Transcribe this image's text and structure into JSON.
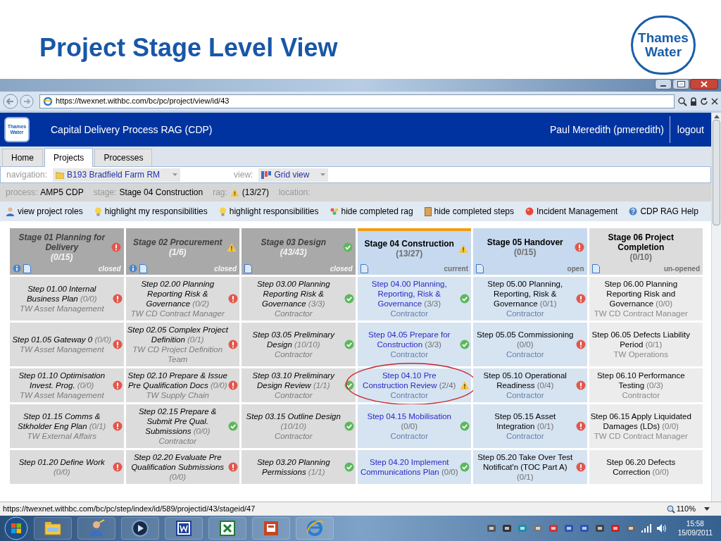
{
  "slide": {
    "title": "Project Stage Level View",
    "logo": [
      "Thames",
      "Water"
    ]
  },
  "browser": {
    "url": "https://twexnet.withbc.com/bc/pc/project/view/id/43",
    "status_url": "https://twexnet.withbc.com/bc/pc/step/index/id/589/projectid/43/stageid/47",
    "zoom": "110%"
  },
  "app": {
    "logo": [
      "Thames",
      "Water"
    ],
    "title": "Capital Delivery Process RAG (CDP)",
    "user": "Paul Meredith (pmeredith)",
    "logout": "logout"
  },
  "tabs": [
    {
      "label": "Home",
      "selected": false
    },
    {
      "label": "Projects",
      "selected": true
    },
    {
      "label": "Processes",
      "selected": false
    }
  ],
  "navigation": {
    "label": "navigation:",
    "value": "B193 Bradfield Farm RM",
    "view_label": "view:",
    "view_value": "Grid view"
  },
  "info_bar": [
    {
      "label": "process:",
      "value": "AMP5 CDP"
    },
    {
      "label": "stage:",
      "value": "Stage 04 Construction"
    },
    {
      "label": "rag:",
      "value": "(13/27)",
      "color": "#f6c744"
    },
    {
      "label": "location:"
    }
  ],
  "toolbar": [
    {
      "kind": "person",
      "label": "view project roles"
    },
    {
      "kind": "bulb",
      "label": "highlight my responsibilities"
    },
    {
      "kind": "bulb",
      "label": "highlight responsibilities"
    },
    {
      "kind": "dots",
      "label": "hide completed rag"
    },
    {
      "kind": "box",
      "label": "hide completed steps"
    },
    {
      "kind": "ball",
      "label": "Incident Management"
    },
    {
      "kind": "help",
      "label": "CDP RAG Help"
    }
  ],
  "stages": [
    {
      "title": "Stage 01 Planning for Delivery",
      "count": "(0/15)",
      "color": "#e2574c",
      "status": "closed",
      "kind": "closed",
      "info": true,
      "steps": [
        {
          "title": "Step 01.00 Internal Business Plan",
          "count": "(0/0)",
          "owner": "TW Asset Management",
          "color": "#e2574c"
        },
        {
          "title": "Step 01.05 Gateway 0",
          "count": "(0/0)",
          "owner": "TW Asset Management",
          "color": "#e2574c"
        },
        {
          "title": "Step 01.10 Optimisation Invest. Prog.",
          "count": "(0/0)",
          "owner": "TW Asset Management",
          "color": "#e2574c"
        },
        {
          "title": "Step 01.15 Comms & Stkholder Eng Plan",
          "count": "(0/1)",
          "owner": "TW External Affairs",
          "color": "#e2574c"
        },
        {
          "title": "Step 01.20 Define Work",
          "count": "(0/0)",
          "color": "#e2574c"
        }
      ]
    },
    {
      "title": "Stage 02 Procurement",
      "count": "(1/6)",
      "color": "#f6c744",
      "status": "closed",
      "kind": "closed",
      "info": true,
      "steps": [
        {
          "title": "Step 02.00 Planning Reporting Risk & Governance",
          "count": "(0/2)",
          "owner": "TW CD Contract Manager",
          "color": "#e2574c"
        },
        {
          "title": "Step 02.05 Complex Project Definition",
          "count": "(0/1)",
          "owner": "TW CD Project Definition Team",
          "color": "#e2574c"
        },
        {
          "title": "Step 02.10 Prepare & Issue Pre Qualification Docs",
          "count": "(0/0)",
          "owner": "TW Supply Chain",
          "color": "#e2574c"
        },
        {
          "title": "Step 02.15 Prepare & Submit Pre Qual. Submissions",
          "count": "(0/0)",
          "owner": "Contractor",
          "color": "#5cb85c"
        },
        {
          "title": "Step 02.20 Evaluate Pre Qualification Submissions",
          "count": "(0/0)",
          "color": "#e2574c"
        }
      ]
    },
    {
      "title": "Stage 03 Design",
      "count": "(43/43)",
      "color": "#5cb85c",
      "status": "closed",
      "kind": "closed",
      "info": false,
      "steps": [
        {
          "title": "Step 03.00 Planning Reporting Risk & Governance",
          "count": "(3/3)",
          "owner": "Contractor",
          "color": "#5cb85c"
        },
        {
          "title": "Step 03.05 Preliminary Design",
          "count": "(10/10)",
          "owner": "Contractor",
          "color": "#5cb85c"
        },
        {
          "title": "Step 03.10 Preliminary Design Review",
          "count": "(1/1)",
          "owner": "Contractor",
          "color": "#5cb85c"
        },
        {
          "title": "Step 03.15 Outline Design",
          "count": "(10/10)",
          "owner": "Contractor",
          "color": "#5cb85c"
        },
        {
          "title": "Step 03.20 Planning Permissions",
          "count": "(1/1)",
          "color": "#5cb85c"
        }
      ]
    },
    {
      "title": "Stage 04 Construction",
      "count": "(13/27)",
      "color": "#f6c744",
      "status": "current",
      "kind": "current",
      "info": false,
      "steps": [
        {
          "title": "Step 04.00 Planning, Reporting, Risk & Governance",
          "count": "(3/3)",
          "owner": "Contractor",
          "color": "#5cb85c"
        },
        {
          "title": "Step 04.05 Prepare for Construction",
          "count": "(3/3)",
          "owner": "Contractor",
          "color": "#5cb85c"
        },
        {
          "title": "Step 04.10 Pre Construction Review",
          "count": "(2/4)",
          "owner": "Contractor",
          "color": "#f6c744",
          "circled": true
        },
        {
          "title": "Step 04.15 Mobilisation",
          "count": "(0/0)",
          "owner": "Contractor",
          "color": "#5cb85c"
        },
        {
          "title": "Step 04.20 Implement Communications Plan",
          "count": "(0/0)",
          "color": "#5cb85c"
        }
      ]
    },
    {
      "title": "Stage 05 Handover",
      "count": "(0/15)",
      "color": "#e2574c",
      "status": "open",
      "kind": "open",
      "info": false,
      "steps": [
        {
          "title": "Step 05.00 Planning, Reporting, Risk & Governance",
          "count": "(0/1)",
          "owner": "Contractor",
          "color": "#e2574c"
        },
        {
          "title": "Step 05.05 Commissioning",
          "count": "(0/0)",
          "owner": "Contractor",
          "color": "#e2574c"
        },
        {
          "title": "Step 05.10 Operational Readiness",
          "count": "(0/4)",
          "owner": "Contractor",
          "color": "#e2574c"
        },
        {
          "title": "Step 05.15 Asset Integration",
          "count": "(0/1)",
          "owner": "Contractor",
          "color": "#e2574c"
        },
        {
          "title": "Step 05.20 Take Over Test Notificat'n (TOC Part A)",
          "count": "(0/1)",
          "color": "#e2574c"
        }
      ]
    },
    {
      "title": "Stage 06 Project Completion",
      "count": "(0/10)",
      "status": "un-opened",
      "kind": "unopened",
      "info": false,
      "steps": [
        {
          "title": "Step 06.00 Planning Reporting Risk and Governance",
          "count": "(0/0)",
          "owner": "TW CD Contract Manager"
        },
        {
          "title": "Step 06.05 Defects Liability Period",
          "count": "(0/1)",
          "owner": "TW Operations"
        },
        {
          "title": "Step 06.10 Performance Testing",
          "count": "(0/3)",
          "owner": "Contractor"
        },
        {
          "title": "Step 06.15 Apply Liquidated Damages (LDs)",
          "count": "(0/0)",
          "owner": "TW CD Contract Manager"
        },
        {
          "title": "Step 06.20 Defects Correction",
          "count": "(0/0)"
        }
      ]
    }
  ],
  "taskbar": {
    "apps": [
      {
        "kind": "folder"
      },
      {
        "kind": "person"
      },
      {
        "kind": "media"
      },
      {
        "kind": "word"
      },
      {
        "kind": "excel"
      },
      {
        "kind": "powerpoint"
      },
      {
        "kind": "browser"
      }
    ],
    "time": "15:58",
    "date": "15/09/2011"
  }
}
